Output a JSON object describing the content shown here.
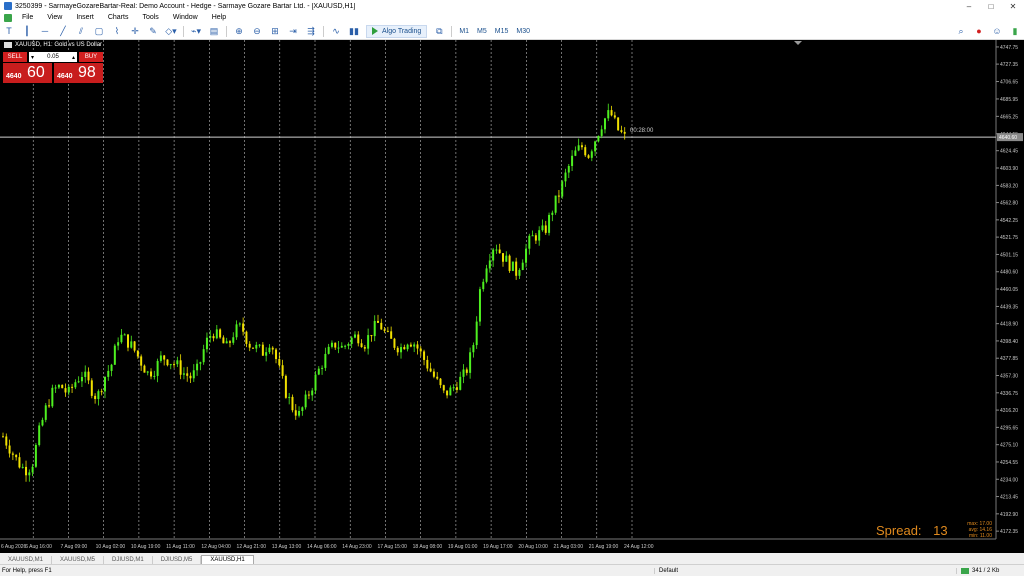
{
  "window": {
    "title": "3250399 - SarmayeGozareBartar-Real: Demo Account - Hedge - Sarmaye Gozare Bartar Ltd. - [XAUUSD,H1]",
    "min_glyph": "–",
    "max_glyph": "□",
    "close_glyph": "✕"
  },
  "menu": [
    "File",
    "View",
    "Insert",
    "Charts",
    "Tools",
    "Window",
    "Help"
  ],
  "toolbar": {
    "algo_label": "Algo Trading",
    "timeframes": [
      "M1",
      "M5",
      "M15",
      "M30"
    ]
  },
  "chart": {
    "symbol_label": "XAUUSD, H1: Gold vs US Dollar",
    "countdown": "00:28:00",
    "current_price_label": "4640.60"
  },
  "trade_panel": {
    "sell_label": "SELL",
    "buy_label": "BUY",
    "lot": "0.05",
    "sell_small": "4640",
    "sell_big": "60",
    "buy_small": "4640",
    "buy_big": "98"
  },
  "spread": {
    "label": "Spread:",
    "value": "13",
    "max": "max: 17.00",
    "avg": "avg: 14.16",
    "min": "min: 11.00"
  },
  "tabs": [
    "XAUUSD,M1",
    "XAUUSD,M5",
    "DJIUSD,M1",
    "DJIUSD,M5",
    "XAUUSD,H1"
  ],
  "active_tab": "XAUUSD,H1",
  "status": {
    "help": "For Help, press F1",
    "profile": "Default",
    "traffic": "341 / 2 Kb"
  },
  "chart_data": {
    "type": "candlestick",
    "y_ticks": [
      "4747.75",
      "4727.35",
      "4706.65",
      "4685.95",
      "4665.25",
      "4644.55",
      "4624.45",
      "4603.90",
      "4583.20",
      "4562.80",
      "4542.25",
      "4521.75",
      "4501.15",
      "4480.60",
      "4460.05",
      "4439.35",
      "4418.90",
      "4398.40",
      "4377.85",
      "4357.30",
      "4336.75",
      "4316.20",
      "4295.65",
      "4275.10",
      "4254.55",
      "4234.00",
      "4213.45",
      "4192.90",
      "4172.35"
    ],
    "x_ticks": [
      "6 Aug 2026",
      "6 Aug 16:00",
      "7 Aug 09:00",
      "10 Aug 02:00",
      "10 Aug 19:00",
      "11 Aug 11:00",
      "12 Aug 04:00",
      "12 Aug 21:00",
      "13 Aug 13:00",
      "14 Aug 06:00",
      "14 Aug 23:00",
      "17 Aug 15:00",
      "18 Aug 08:00",
      "19 Aug 01:00",
      "19 Aug 17:00",
      "20 Aug 10:00",
      "21 Aug 03:00",
      "21 Aug 19:00",
      "24 Aug 12:00"
    ],
    "y_range": [
      4163.0,
      4756.0
    ],
    "current_price": 4640.6,
    "up_color": "#4ef020",
    "down_color": "#f0e000",
    "close_path": [
      4285,
      4270,
      4255,
      4245,
      4250,
      4290,
      4320,
      4340,
      4345,
      4335,
      4350,
      4360,
      4345,
      4330,
      4355,
      4370,
      4405,
      4400,
      4390,
      4375,
      4360,
      4365,
      4380,
      4375,
      4370,
      4360,
      4355,
      4365,
      4395,
      4410,
      4400,
      4390,
      4410,
      4415,
      4395,
      4390,
      4385,
      4400,
      4370,
      4340,
      4320,
      4310,
      4330,
      4350,
      4370,
      4385,
      4395,
      4390,
      4400,
      4405,
      4395,
      4410,
      4420,
      4405,
      4395,
      4390,
      4400,
      4395,
      4380,
      4365,
      4350,
      4335,
      4340,
      4350,
      4360,
      4390,
      4460,
      4495,
      4515,
      4500,
      4490,
      4480,
      4500,
      4520,
      4525,
      4530,
      4555,
      4575,
      4600,
      4620,
      4630,
      4620,
      4640,
      4660,
      4670,
      4650,
      4640
    ]
  }
}
